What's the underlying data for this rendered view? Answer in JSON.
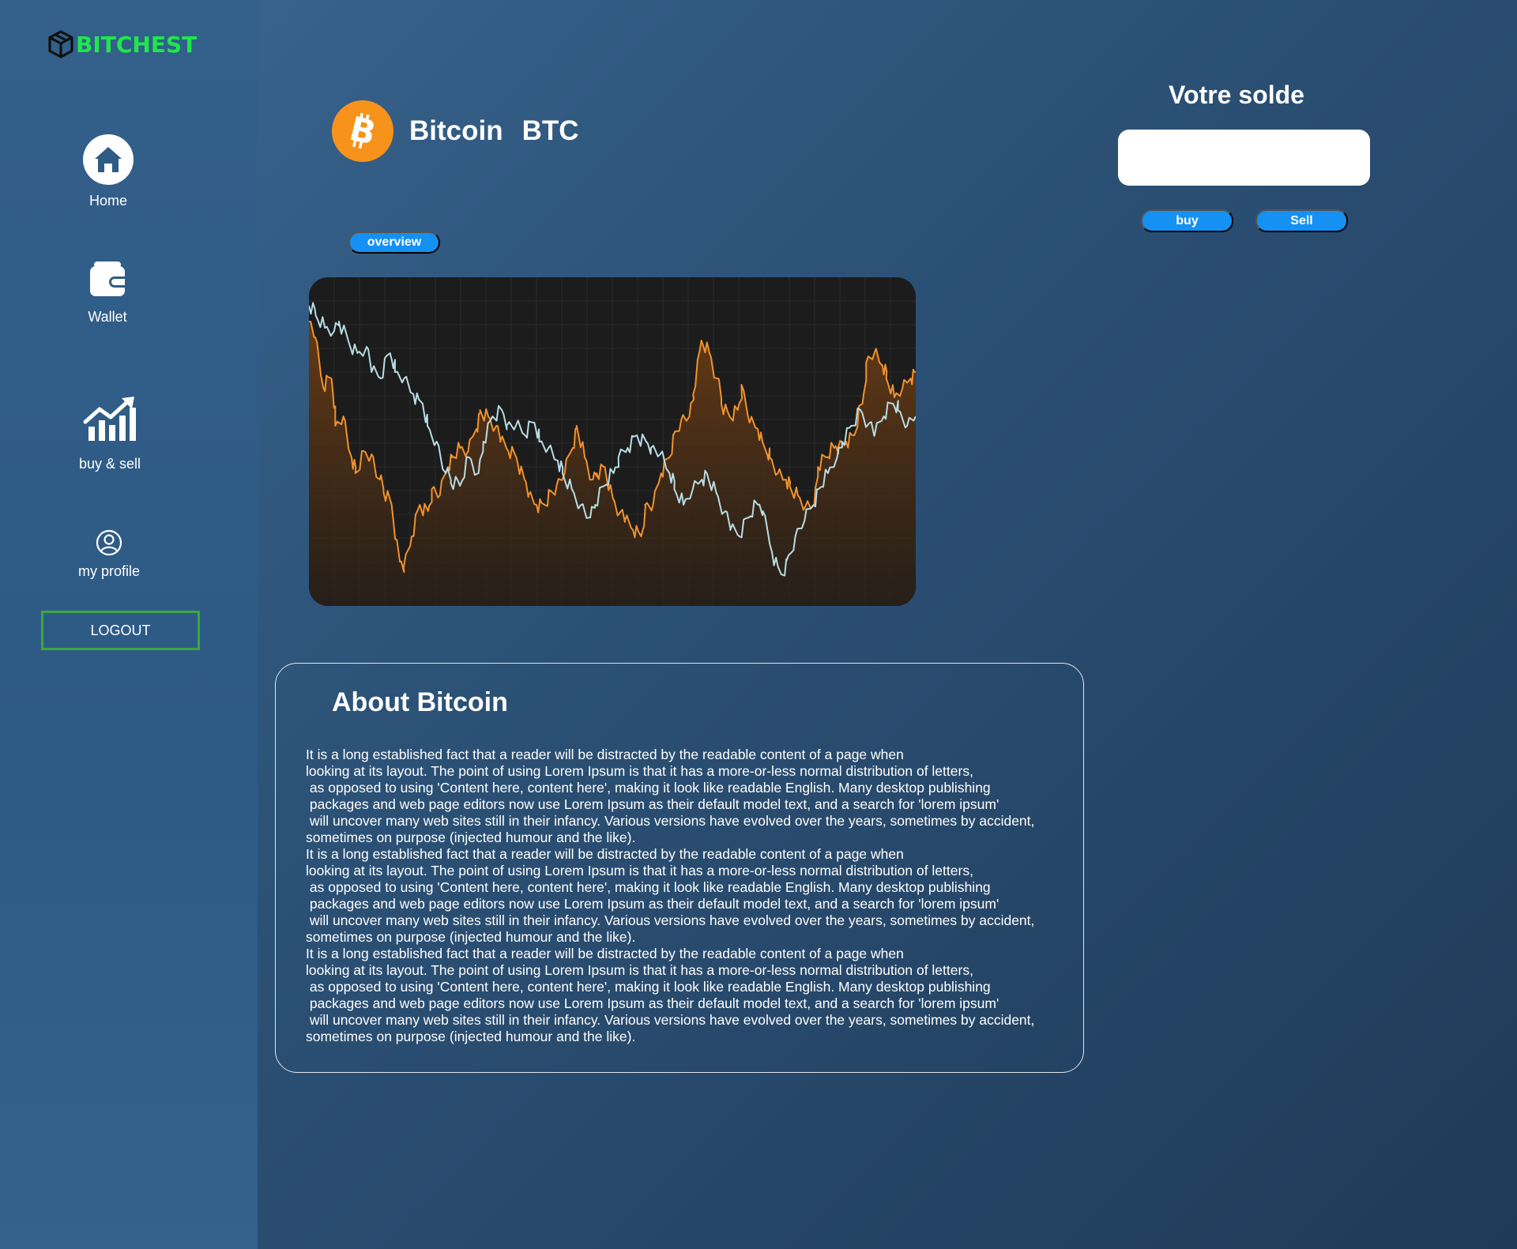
{
  "app": {
    "logo_text": "BITCHEST",
    "logo_color": "#1ee84a"
  },
  "sidebar": {
    "items": [
      {
        "label": "Home",
        "icon": "home-icon"
      },
      {
        "label": "Wallet",
        "icon": "wallet-icon"
      },
      {
        "label": "buy & sell",
        "icon": "chart-up-icon"
      },
      {
        "label": "my profile",
        "icon": "user-circle-icon"
      }
    ],
    "logout_label": "LOGOUT"
  },
  "coin": {
    "name": "Bitcoin",
    "symbol": "BTC",
    "icon": "bitcoin-icon",
    "color": "#f7931a"
  },
  "tabs": {
    "overview_label": "overview"
  },
  "chart_data": {
    "type": "line",
    "title": "",
    "xlabel": "",
    "ylabel": "",
    "grid": true,
    "series": [
      {
        "color": "#f0922e",
        "fill": true,
        "values": [
          88,
          83,
          67,
          70,
          55,
          58,
          45,
          40,
          47,
          46,
          38,
          34,
          30,
          12,
          10,
          20,
          30,
          28,
          35,
          33,
          42,
          45,
          48,
          47,
          54,
          60,
          58,
          55,
          50,
          47,
          45,
          38,
          33,
          30,
          30,
          34,
          36,
          40,
          48,
          55,
          45,
          38,
          40,
          42,
          32,
          28,
          25,
          22,
          20,
          30,
          30,
          40,
          45,
          52,
          57,
          58,
          65,
          82,
          78,
          70,
          62,
          58,
          60,
          68,
          56,
          54,
          47,
          45,
          40,
          38,
          36,
          33,
          30,
          30,
          42,
          45,
          48,
          48,
          50,
          52,
          62,
          75,
          78,
          74,
          70,
          64,
          67,
          70,
          72
        ]
      },
      {
        "color": "#b9dde4",
        "fill": false,
        "values": [
          93,
          90,
          86,
          85,
          88,
          82,
          78,
          80,
          72,
          70,
          78,
          72,
          70,
          65,
          62,
          55,
          50,
          40,
          37,
          36,
          45,
          40,
          50,
          58,
          60,
          55,
          55,
          52,
          56,
          50,
          48,
          44,
          40,
          35,
          30,
          26,
          30,
          36,
          40,
          45,
          48,
          52,
          50,
          48,
          46,
          40,
          35,
          30,
          35,
          38,
          40,
          34,
          28,
          22,
          20,
          26,
          30,
          28,
          15,
          8,
          12,
          20,
          25,
          30,
          35,
          40,
          45,
          50,
          55,
          60,
          56,
          52,
          58,
          62,
          60,
          55,
          58
        ]
      }
    ]
  },
  "balance": {
    "title": "Votre solde",
    "value": "",
    "buy_label": "buy",
    "sell_label": "Sell",
    "button_color": "#1591f3"
  },
  "about": {
    "title": "About Bitcoin",
    "paragraph_lines": [
      "It is a long established fact that a reader will be distracted by the readable content of a page when",
      "looking at its layout. The point of using Lorem Ipsum is that it has a more-or-less normal distribution of letters,",
      " as opposed to using 'Content here, content here', making it look like readable English. Many desktop publishing",
      " packages and web page editors now use Lorem Ipsum as their default model text, and a search for 'lorem ipsum'",
      " will uncover many web sites still in their infancy. Various versions have evolved over the years, sometimes by accident,",
      "sometimes on purpose (injected humour and the like)."
    ]
  }
}
